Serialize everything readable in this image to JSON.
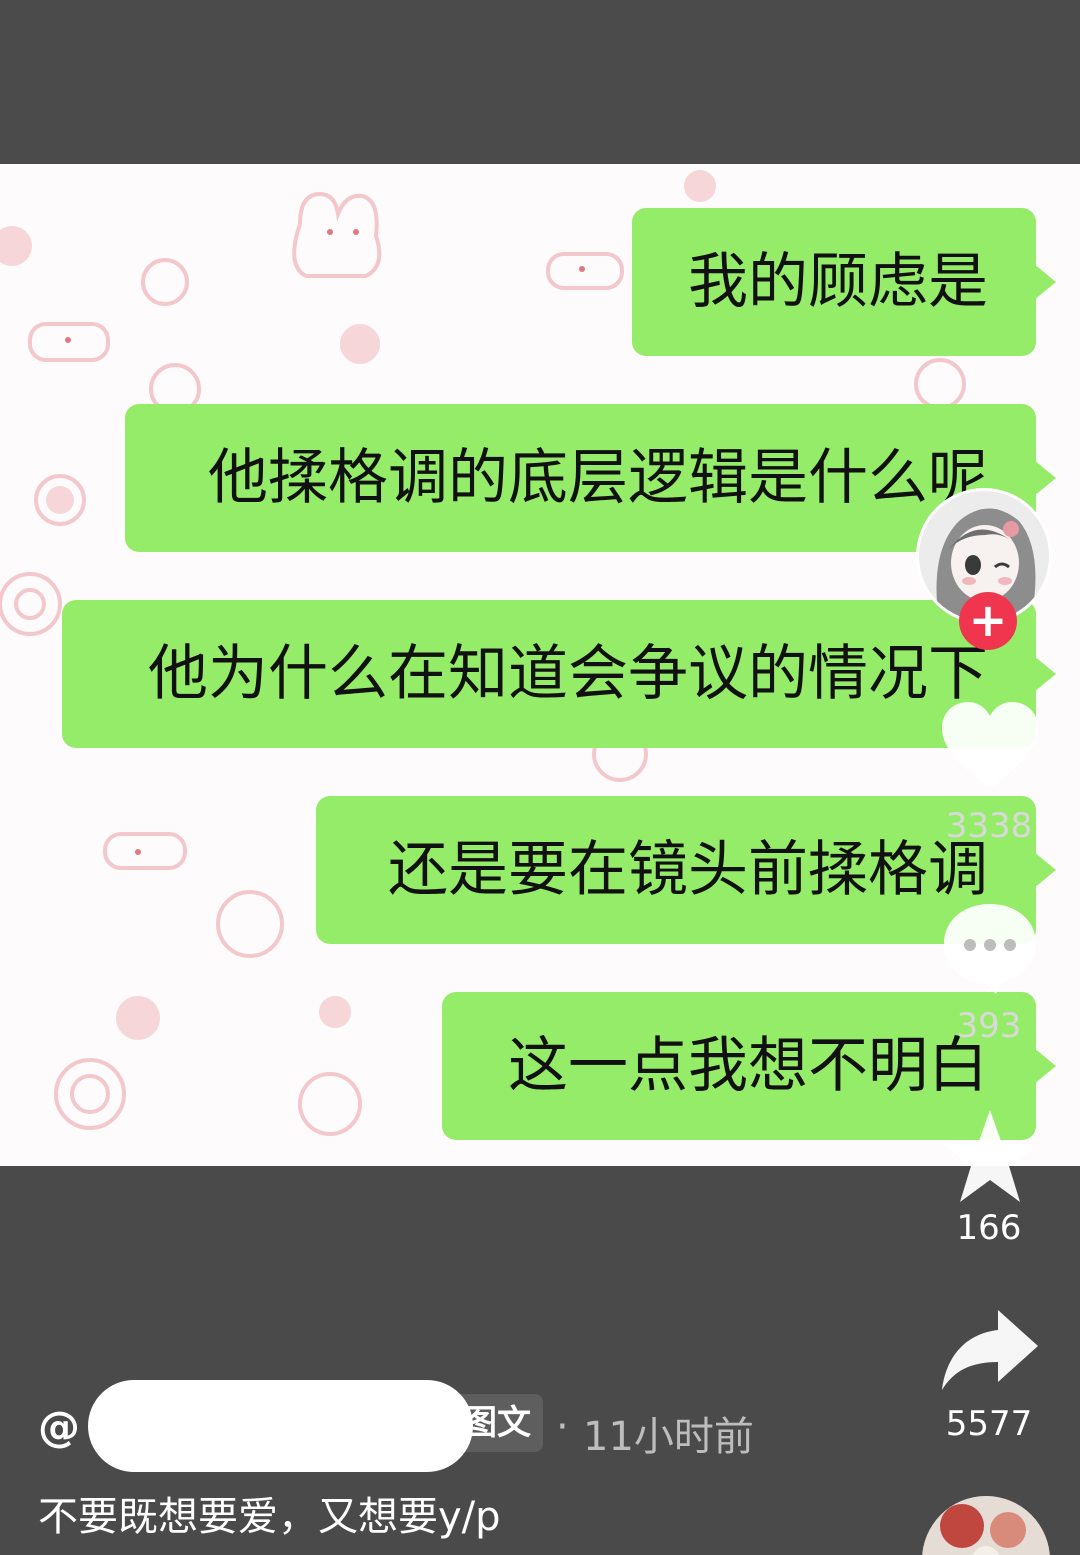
{
  "messages": [
    {
      "text": "我的顾虑是"
    },
    {
      "text": "他揉格调的底层逻辑是什么呢"
    },
    {
      "text": "他为什么在知道会争议的情况下"
    },
    {
      "text": "还是要在镜头前揉格调"
    },
    {
      "text": "这一点我想不明白"
    }
  ],
  "sidebar": {
    "follow_symbol": "+",
    "like_count": "3338",
    "comment_count": "393",
    "favorite_count": "166",
    "share_count": "5577"
  },
  "post": {
    "at_symbol": "@",
    "type_tag": "图文",
    "separator": "·",
    "time": "11小时前",
    "caption": "不要既想要爱，又想要y/p"
  },
  "colors": {
    "bubble": "#95ec69",
    "background": "#4a4a4a",
    "follow_badge": "#f0364e"
  },
  "icons": [
    "heart-icon",
    "comment-icon",
    "star-icon",
    "share-icon",
    "plus-icon"
  ]
}
